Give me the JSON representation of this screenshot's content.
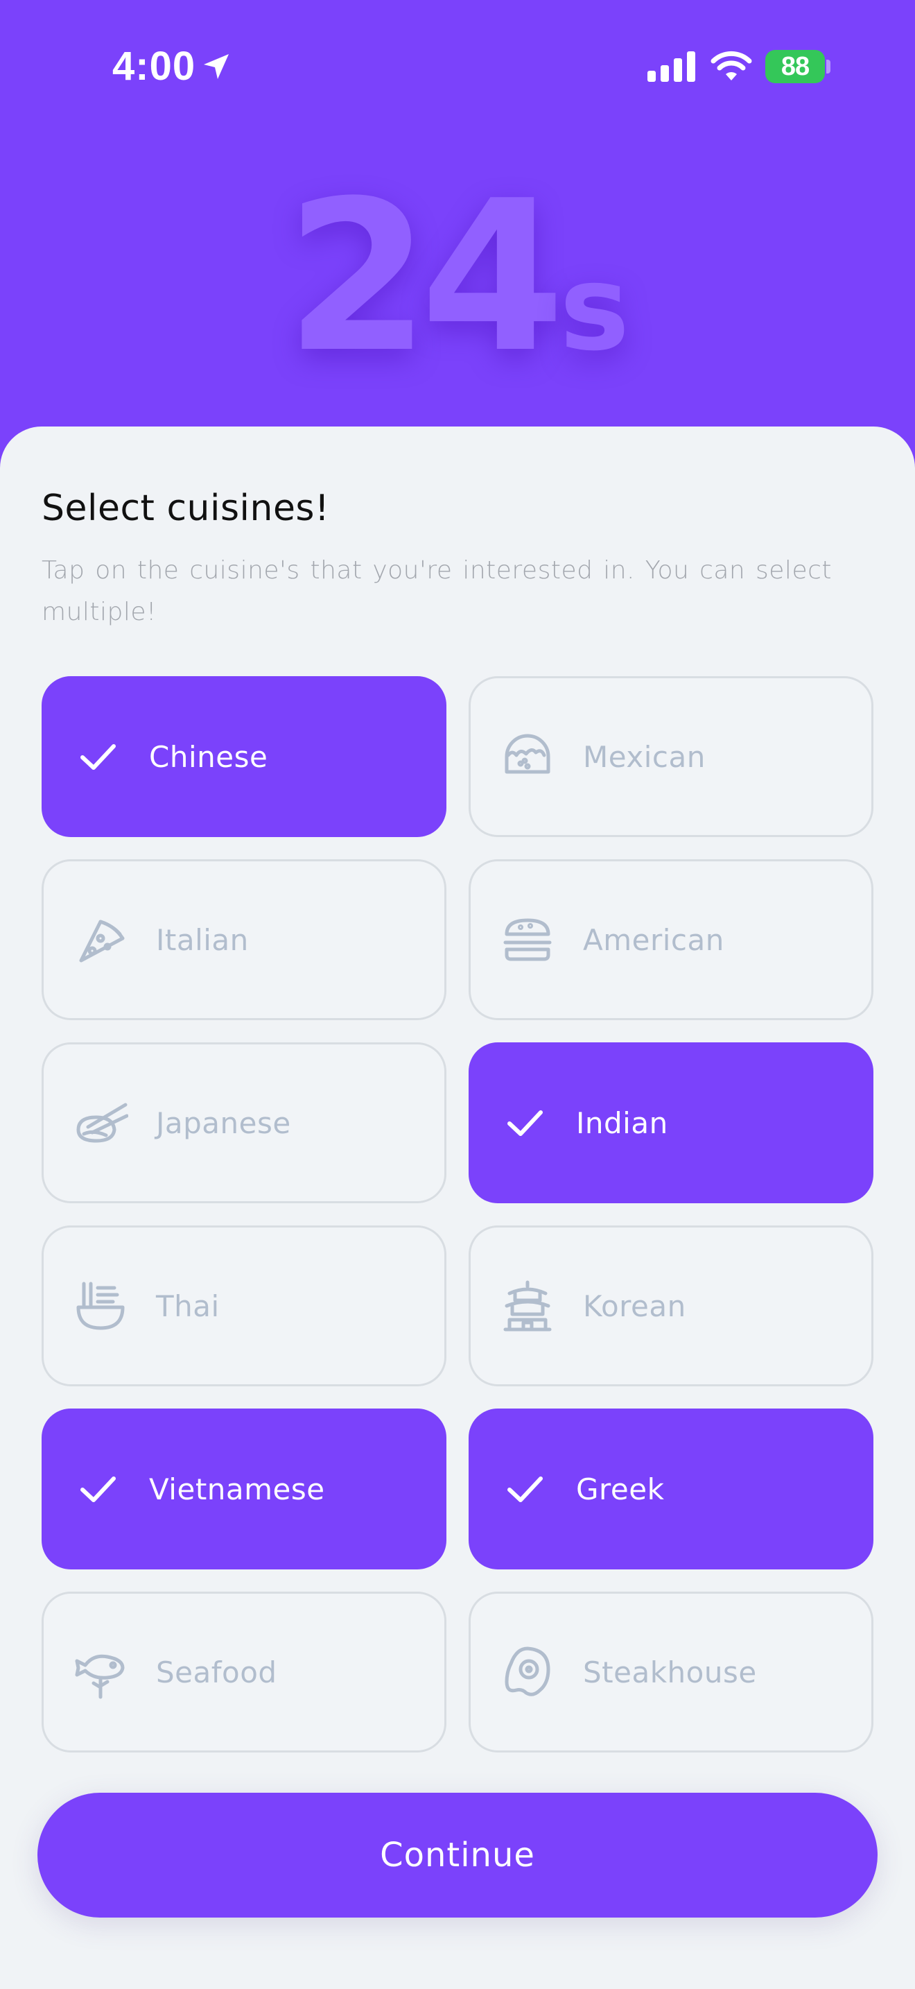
{
  "status_bar": {
    "time": "4:00",
    "battery": "88",
    "icons": [
      "location-arrow-icon",
      "cellular-signal-icon",
      "wifi-icon",
      "battery-charging-icon"
    ]
  },
  "timer": {
    "value": "24",
    "unit": "s"
  },
  "sheet": {
    "title": "Select  cuisines!",
    "subtitle": "Tap on the cuisine's that you're interested in. You can select multiple!"
  },
  "cuisines": [
    {
      "label": "Chinese",
      "selected": true,
      "icon": "check-icon"
    },
    {
      "label": "Mexican",
      "selected": false,
      "icon": "taco-icon"
    },
    {
      "label": "Italian",
      "selected": false,
      "icon": "pizza-slice-icon"
    },
    {
      "label": "American",
      "selected": false,
      "icon": "burger-icon"
    },
    {
      "label": "Japanese",
      "selected": false,
      "icon": "sushi-chopsticks-icon"
    },
    {
      "label": "Indian",
      "selected": true,
      "icon": "check-icon"
    },
    {
      "label": "Thai",
      "selected": false,
      "icon": "noodle-bowl-icon"
    },
    {
      "label": "Korean",
      "selected": false,
      "icon": "pagoda-icon"
    },
    {
      "label": "Vietnamese",
      "selected": true,
      "icon": "check-icon"
    },
    {
      "label": "Greek",
      "selected": true,
      "icon": "check-icon"
    },
    {
      "label": "Seafood",
      "selected": false,
      "icon": "fish-icon"
    },
    {
      "label": "Steakhouse",
      "selected": false,
      "icon": "steak-icon"
    }
  ],
  "continue_label": "Continue",
  "colors": {
    "accent": "#7b42fb",
    "sheet_bg": "#f0f3f6",
    "unselected_text": "#b1bdcd",
    "battery_green": "#34c759"
  }
}
